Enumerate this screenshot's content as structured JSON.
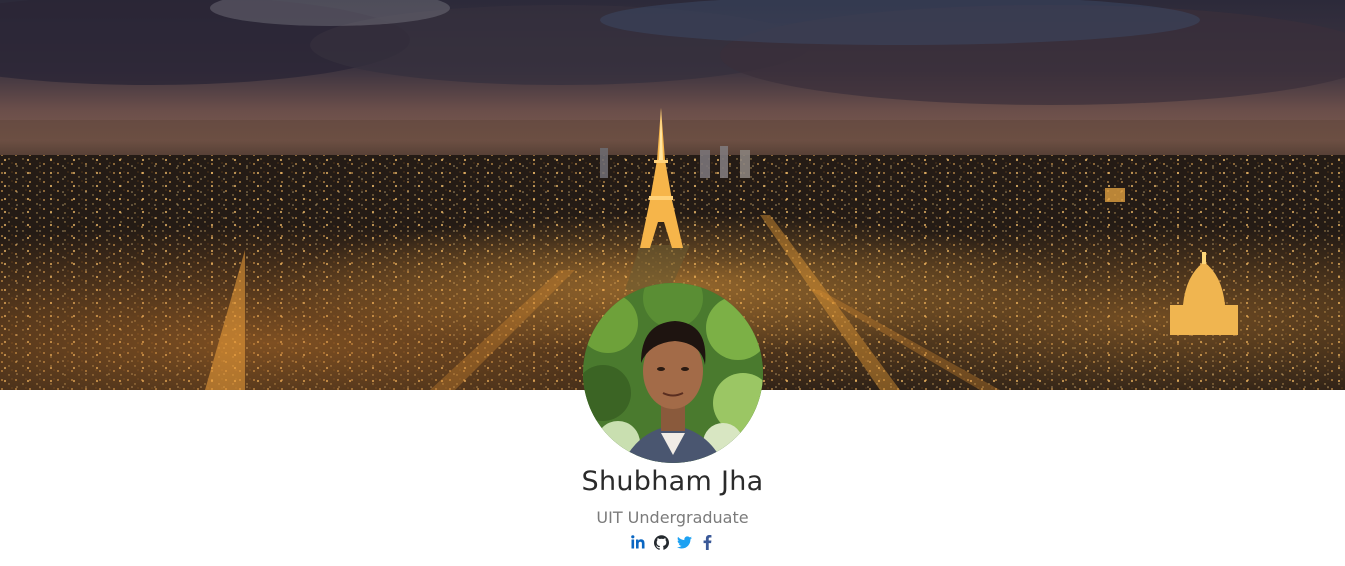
{
  "profile": {
    "name": "Shubham Jha",
    "subtitle": "UIT Undergraduate"
  },
  "cover": {
    "image": "city-skyline-at-night-with-eiffel-tower"
  },
  "avatar": {
    "image": "profile-photo"
  },
  "social_links": [
    {
      "icon": "linkedin-icon",
      "color": "#0a66c2"
    },
    {
      "icon": "github-icon",
      "color": "#24292e"
    },
    {
      "icon": "twitter-icon",
      "color": "#1da1f2"
    },
    {
      "icon": "facebook-icon",
      "color": "#3b5998"
    }
  ],
  "colors": {
    "name_text": "#2b2b2b",
    "subtitle_text": "#7b7b7b",
    "background": "#ffffff"
  }
}
